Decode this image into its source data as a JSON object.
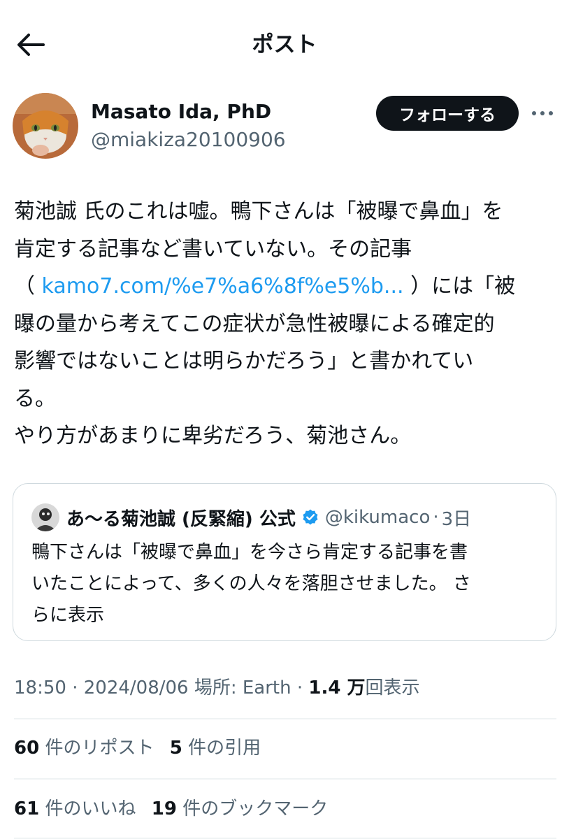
{
  "header": {
    "title": "ポスト",
    "back_icon": "arrow-left-icon"
  },
  "author": {
    "display_name": "Masato Ida, PhD",
    "handle": "@miakiza20100906",
    "follow_label": "フォローする",
    "more_icon": "more-horizontal-icon"
  },
  "tweet": {
    "lines": [
      "菊池誠 氏のこれは嘘。鴨下さんは「被曝で鼻血」を",
      "肯定する記事など書いていない。その記事",
      "（",
      "kamo7.com/%e7%a6%8f%e5%b...",
      "）には「被",
      "曝の量から考えてこの症状が急性被曝による確定的",
      "影響ではないことは明らかだろう」と書かれてい",
      "る。",
      "やり方があまりに卑劣だろう、菊池さん。"
    ]
  },
  "quote": {
    "name": "あ〜る菊池誠 (反緊縮) 公式",
    "handle": "@kikumaco",
    "separator": "·",
    "time": "3日",
    "lines": [
      "鴨下さんは「被曝で鼻血」を今さら肯定する記事を書",
      "いたことによって、多くの人々を落胆させました。",
      "さ",
      "らに表示"
    ]
  },
  "meta": {
    "time": "18:50",
    "sep1": " · ",
    "date": "2024/08/06",
    "location": " 場所: Earth",
    "sep2": " · ",
    "views_count": "1.4 万",
    "views_label": "回表示"
  },
  "stats": {
    "reposts_count": "60",
    "reposts_label": "件のリポスト",
    "quotes_count": "5",
    "quotes_label": "件の引用",
    "likes_count": "61",
    "likes_label": "件のいいね",
    "bookmarks_count": "19",
    "bookmarks_label": "件のブックマーク"
  },
  "colors": {
    "link": "#1d9bf0",
    "text": "#0f1419",
    "secondary": "#536471",
    "border": "#cfd9de",
    "verified": "#1d9bf0"
  }
}
